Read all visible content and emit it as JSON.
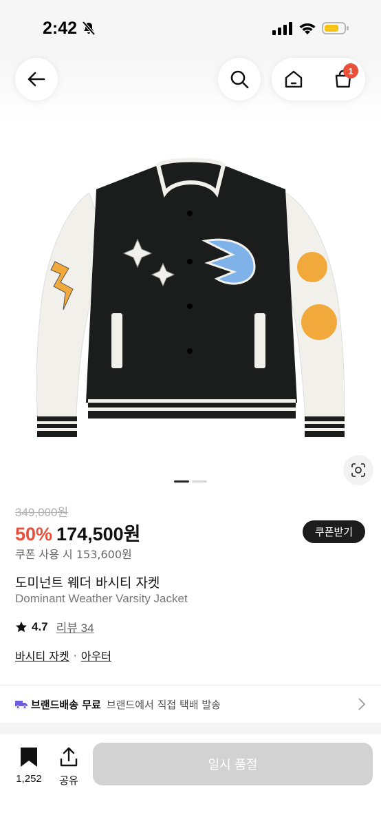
{
  "status": {
    "time": "2:42"
  },
  "nav": {
    "cart_count": "1"
  },
  "product": {
    "original_price": "349,000원",
    "discount": "50%",
    "sale_price": "174,500원",
    "coupon_button": "쿠폰받기",
    "coupon_price": "쿠폰 사용 시 153,600원",
    "title_ko": "도미넌트 웨더 바시티 자켓",
    "title_en": "Dominant Weather Varsity Jacket",
    "rating": "4.7",
    "review_label": "리뷰 34",
    "categories": [
      "바시티 자켓",
      "아우터"
    ],
    "category_separator": "·",
    "image_count": 2,
    "active_image": 1
  },
  "shipping": {
    "label": "브랜드배송 무료",
    "desc": "브랜드에서 직접 택배 발송"
  },
  "bottom_bar": {
    "wish_count": "1,252",
    "share_label": "공유",
    "buy_button": "일시 품절"
  },
  "colors": {
    "accent": "#e8503a",
    "dark": "#1c1c1c",
    "disabled": "#d2d2d2"
  }
}
